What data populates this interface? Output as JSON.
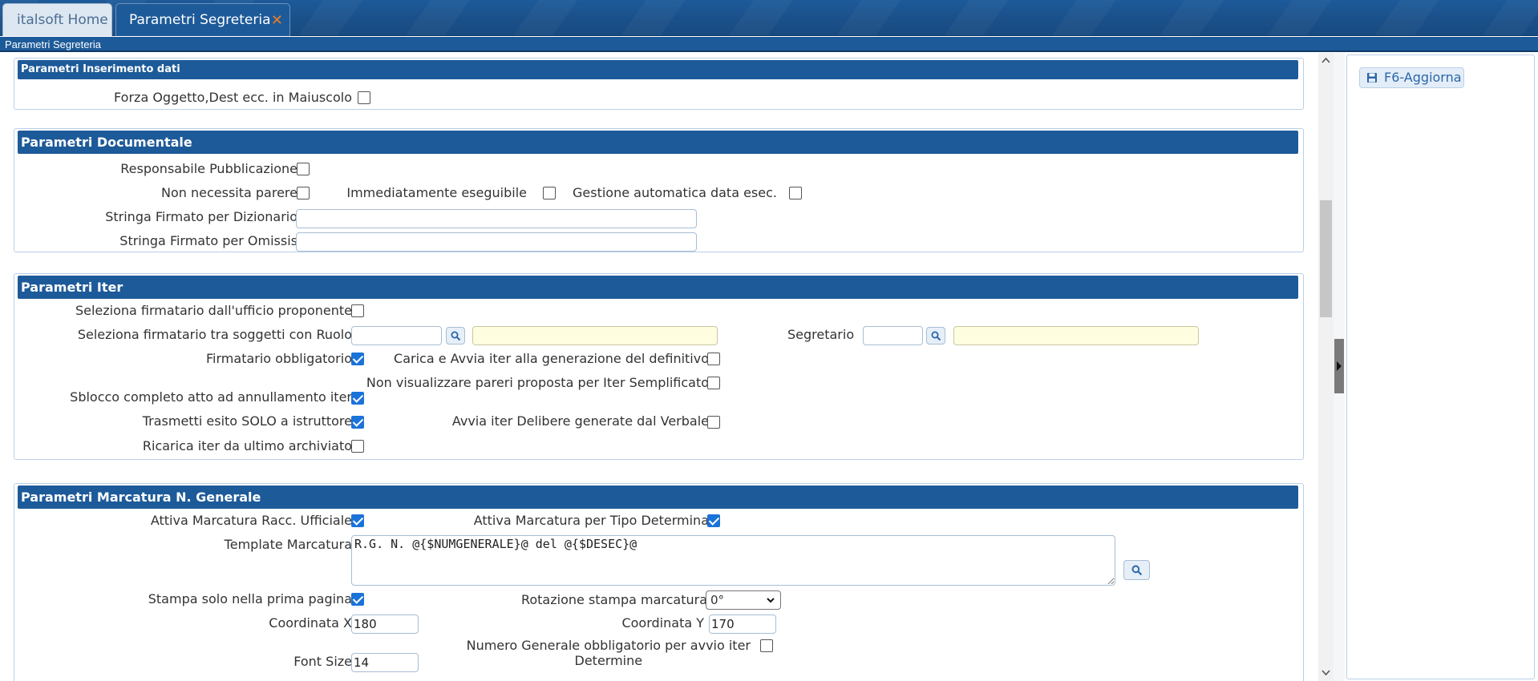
{
  "tabs": {
    "home_label": "italsoft Home",
    "active_label": "Parametri Segreteria",
    "close_glyph": "✕"
  },
  "page_title": "Parametri Segreteria",
  "sections": {
    "inserimento": {
      "title": "Parametri Inserimento dati",
      "forza_maiuscolo_label": "Forza Oggetto,Dest ecc. in Maiuscolo",
      "forza_maiuscolo_checked": false
    },
    "documentale": {
      "title": "Parametri Documentale",
      "responsabile_label": "Responsabile Pubblicazione",
      "non_parere_label": "Non necessita parere",
      "immediatamente_label": "Immediatamente eseguibile",
      "gestione_label": "Gestione automatica data esec.",
      "firmato_diz_label": "Stringa Firmato per Dizionario",
      "firmato_diz_value": "",
      "firmato_om_label": "Stringa Firmato per Omissis",
      "firmato_om_value": ""
    },
    "iter": {
      "title": "Parametri Iter",
      "seleziona_ufficio_label": "Seleziona firmatario dall'ufficio proponente",
      "seleziona_ruolo_label": "Seleziona firmatario tra soggetti con Ruolo",
      "ruolo_code": "",
      "ruolo_desc": "",
      "segretario_label": "Segretario",
      "segretario_code": "",
      "segretario_desc": "",
      "firmatario_obbl_label": "Firmatario obbligatorio",
      "carica_avvia_label": "Carica e Avvia iter alla generazione del definitivo",
      "non_visualizzare_label": "Non visualizzare pareri proposta per Iter Semplificato",
      "sblocco_label": "Sblocco completo atto ad annullamento iter",
      "trasmetti_label": "Trasmetti esito SOLO a istruttore",
      "avvia_delibere_label": "Avvia iter Delibere generate dal Verbale",
      "ricarica_label": "Ricarica iter da ultimo archiviato"
    },
    "marcatura": {
      "title": "Parametri Marcatura N. Generale",
      "attiva_racc_label": "Attiva Marcatura Racc. Ufficiale",
      "attiva_tipo_label": "Attiva Marcatura per Tipo Determina",
      "template_label": "Template Marcatura",
      "template_value": "R.G. N. @{$NUMGENERALE}@ del @{$DESEC}@",
      "stampa_prima_label": "Stampa solo nella prima pagina",
      "rotazione_label": "Rotazione stampa marcatura",
      "rotazione_value": "0°",
      "coord_x_label": "Coordinata X",
      "coord_x_value": "180",
      "coord_y_label": "Coordinata Y",
      "coord_y_value": "170",
      "num_gen_label_1": "Numero Generale obbligatorio per avvio iter",
      "num_gen_label_2": "Determine",
      "font_size_label": "Font Size",
      "font_size_value": "14"
    }
  },
  "right_panel": {
    "aggiorna_label": "F6-Aggiorna"
  },
  "colors": {
    "header_blue": "#1d5a99",
    "checkbox_on": "#1a73d9",
    "lookup_yellow": "#fffde0"
  }
}
